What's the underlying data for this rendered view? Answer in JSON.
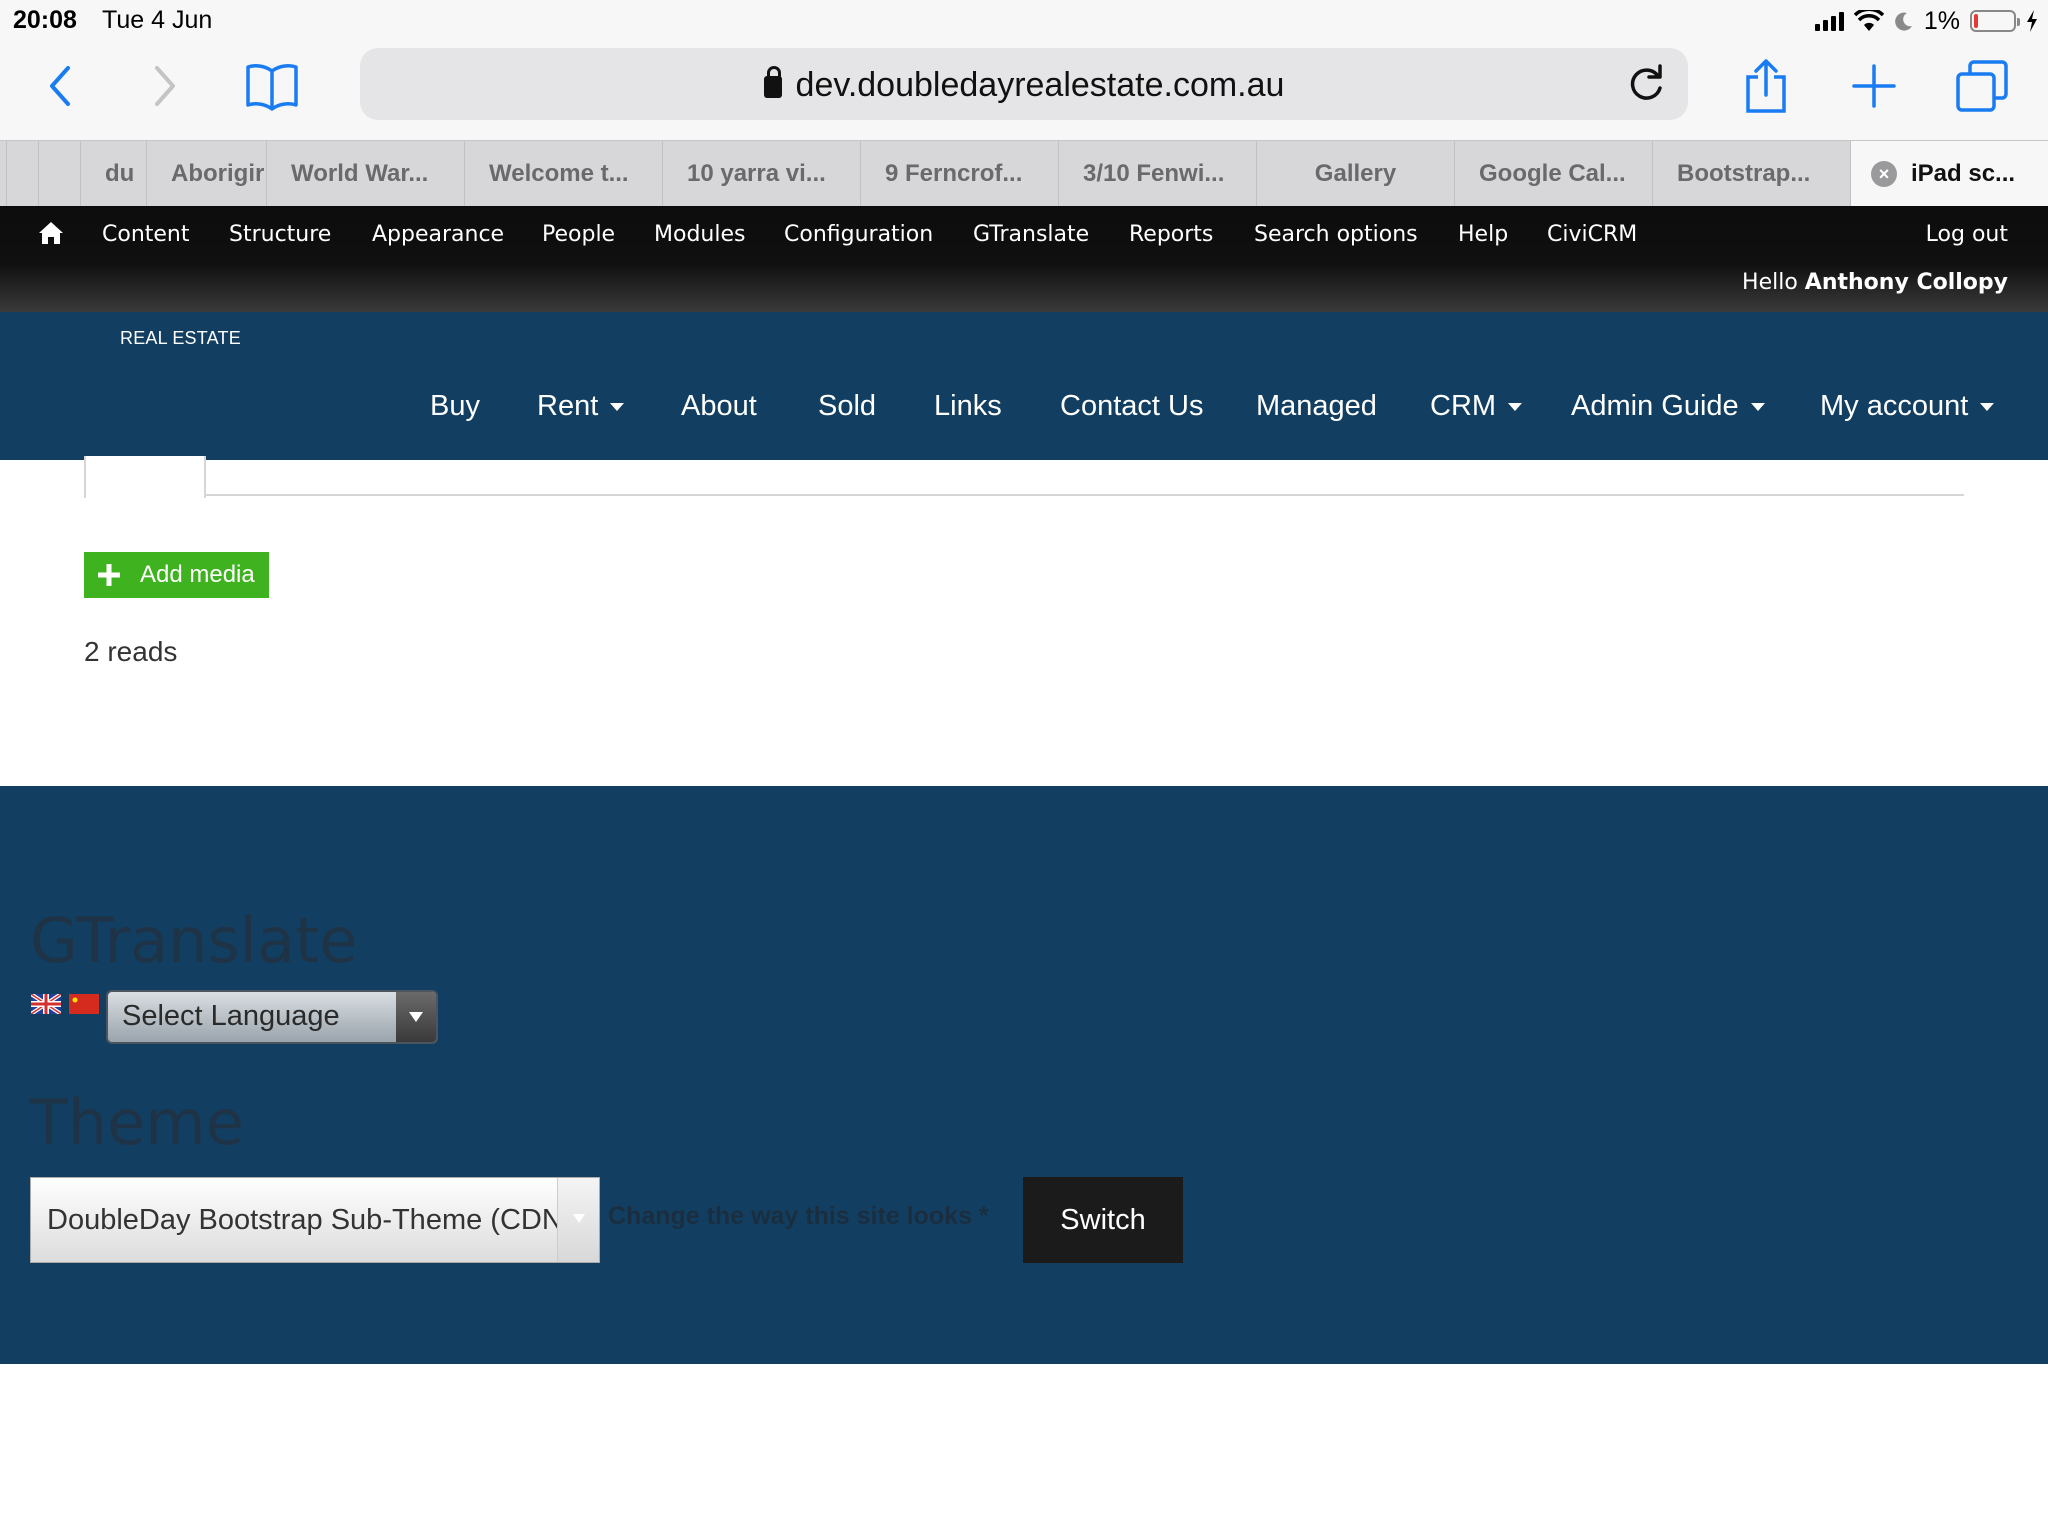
{
  "status_bar": {
    "time": "20:08",
    "date": "Tue 4 Jun",
    "battery": "1%"
  },
  "browser": {
    "url": "dev.doubledayrealestate.com.au",
    "tabs": [
      {
        "label": "du"
      },
      {
        "label": "Aborigir"
      },
      {
        "label": "World War..."
      },
      {
        "label": "Welcome t..."
      },
      {
        "label": "10 yarra vi..."
      },
      {
        "label": "9 Ferncrof..."
      },
      {
        "label": "3/10 Fenwi..."
      },
      {
        "label": "Gallery"
      },
      {
        "label": "Google Cal..."
      },
      {
        "label": "Bootstrap..."
      },
      {
        "label": "iPad sc..."
      }
    ]
  },
  "admin_toolbar": {
    "items": [
      "Content",
      "Structure",
      "Appearance",
      "People",
      "Modules",
      "Configuration",
      "GTranslate",
      "Reports",
      "Search options",
      "Help",
      "CiviCRM"
    ],
    "logout": "Log out",
    "hello_prefix": "Hello",
    "user_name": "Anthony Collopy"
  },
  "site_header": {
    "logo_subtitle": "REAL ESTATE",
    "nav": [
      "Buy",
      "Rent",
      "About",
      "Sold",
      "Links",
      "Contact Us",
      "Managed",
      "CRM",
      "Admin Guide",
      "My account"
    ]
  },
  "content": {
    "add_media_label": "Add media",
    "reads": "2 reads"
  },
  "footer": {
    "gtranslate_title": "GTranslate",
    "language_select": "Select Language",
    "theme_title": "Theme",
    "theme_select": "DoubleDay Bootstrap Sub-Theme (CDN)",
    "theme_hint": "Change the way this site looks *",
    "switch_label": "Switch"
  },
  "colors": {
    "brand_navy": "#123f61",
    "add_green": "#3fb21f",
    "ios_blue": "#1a7cf2"
  }
}
